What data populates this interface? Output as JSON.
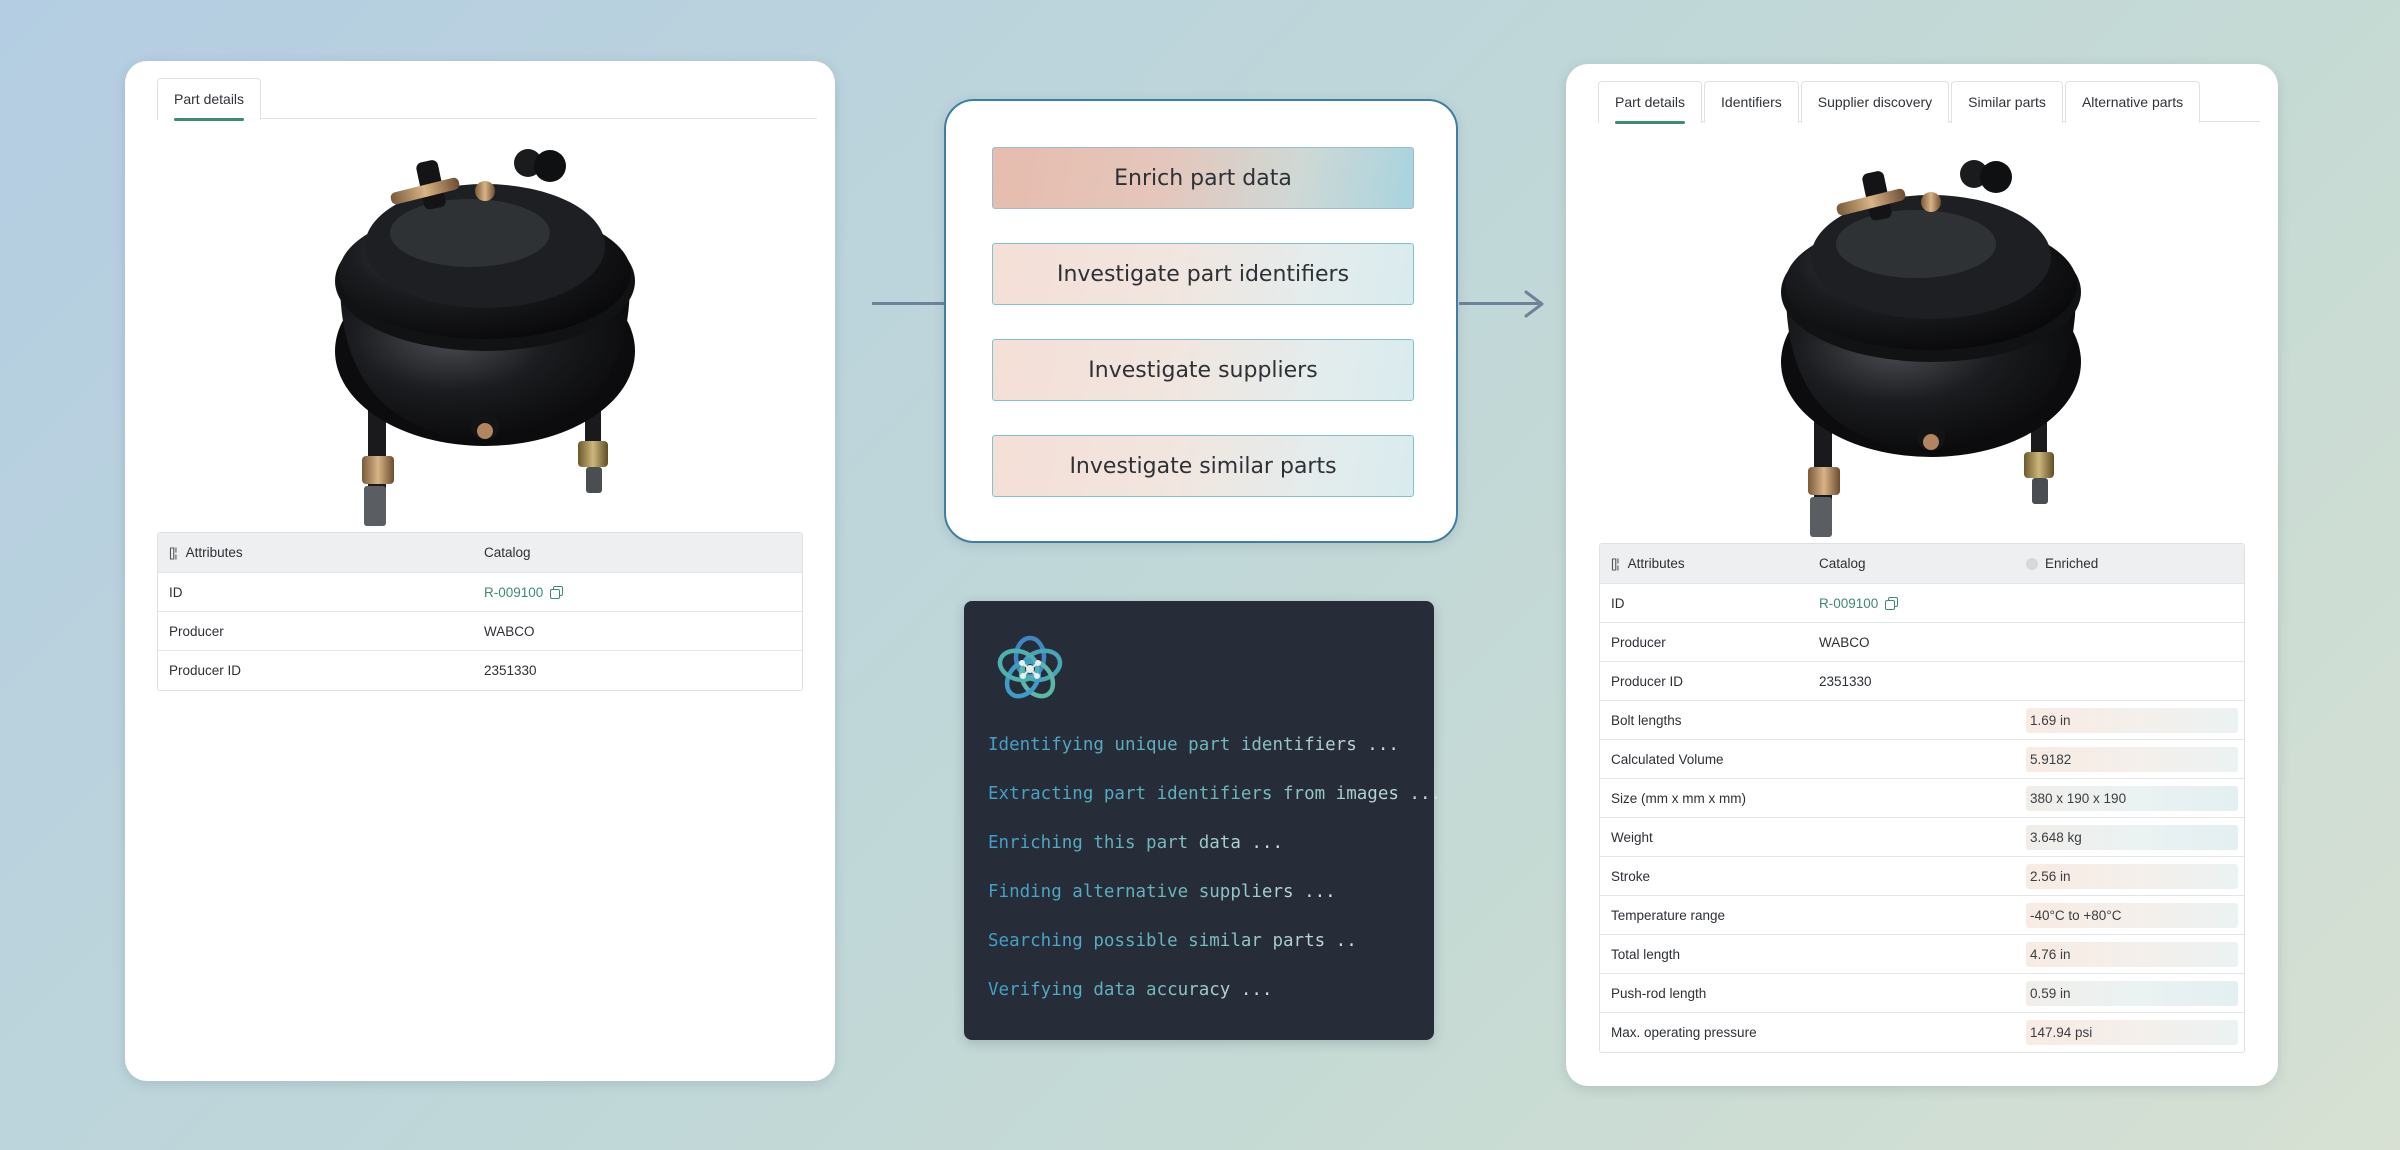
{
  "left_card": {
    "tabs": [
      {
        "label": "Part details"
      }
    ],
    "table": {
      "headers": [
        "Attributes",
        "Catalog"
      ],
      "rows": [
        {
          "name": "ID",
          "catalog": "R-009100"
        },
        {
          "name": "Producer",
          "catalog": "WABCO"
        },
        {
          "name": "Producer ID",
          "catalog": "2351330"
        }
      ]
    }
  },
  "actions": {
    "buttons": [
      {
        "label": "Enrich part data"
      },
      {
        "label": "Investigate part identifiers"
      },
      {
        "label": "Investigate suppliers"
      },
      {
        "label": "Investigate similar parts"
      }
    ]
  },
  "terminal": {
    "logo_icon": "knot-logo-icon",
    "lines": [
      "Identifying unique part identifiers ...",
      "Extracting part identifiers from images ...",
      "Enriching this part data ...",
      "Finding alternative suppliers ...",
      "Searching possible similar parts ..",
      "Verifying data accuracy ..."
    ]
  },
  "right_card": {
    "tabs": [
      {
        "label": "Part details"
      },
      {
        "label": "Identifiers"
      },
      {
        "label": "Supplier discovery"
      },
      {
        "label": "Similar parts"
      },
      {
        "label": "Alternative parts"
      }
    ],
    "table": {
      "headers": [
        "Attributes",
        "Catalog",
        "Enriched"
      ],
      "rows": [
        {
          "name": "ID",
          "catalog": "R-009100",
          "enriched": ""
        },
        {
          "name": "Producer",
          "catalog": "WABCO",
          "enriched": ""
        },
        {
          "name": "Producer ID",
          "catalog": "2351330",
          "enriched": ""
        },
        {
          "name": "Bolt lengths",
          "catalog": "",
          "enriched": "1.69 in"
        },
        {
          "name": "Calculated Volume",
          "catalog": "",
          "enriched": "5.9182"
        },
        {
          "name": "Size (mm x mm x mm)",
          "catalog": "",
          "enriched": "380 x 190 x 190"
        },
        {
          "name": "Weight",
          "catalog": "",
          "enriched": "3.648 kg"
        },
        {
          "name": "Stroke",
          "catalog": "",
          "enriched": "2.56 in"
        },
        {
          "name": "Temperature range",
          "catalog": "",
          "enriched": "-40°C to +80°C"
        },
        {
          "name": "Total length",
          "catalog": "",
          "enriched": "4.76 in"
        },
        {
          "name": "Push-rod length",
          "catalog": "",
          "enriched": "0.59 in"
        },
        {
          "name": "Max. operating pressure",
          "catalog": "",
          "enriched": "147.94 psi"
        }
      ]
    }
  },
  "colors": {
    "accent": "#3d8a75",
    "panel_border": "#3f7ea3",
    "terminal_bg": "#272d38",
    "arrow": "#6f8299"
  }
}
